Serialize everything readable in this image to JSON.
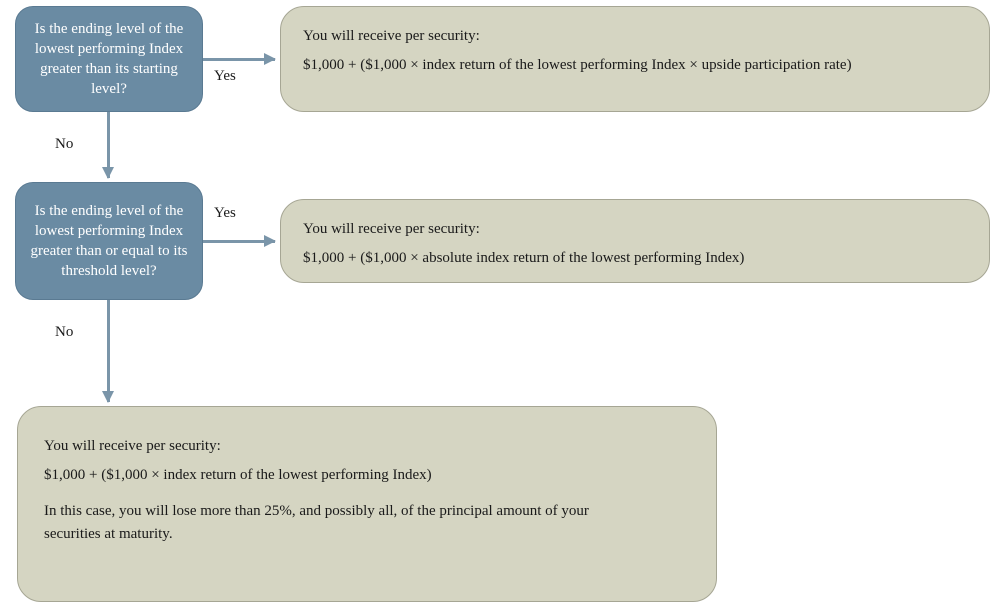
{
  "decision1": {
    "text": "Is the ending level of the lowest performing Index greater than its starting level?"
  },
  "decision2": {
    "text": "Is the ending level of the lowest performing Index greater than or equal to its threshold level?"
  },
  "result1": {
    "line1": "You will receive per security:",
    "line2": "$1,000 + ($1,000 × index return of the lowest performing Index × upside participation rate)"
  },
  "result2": {
    "line1": "You will receive per security:",
    "line2": "$1,000 + ($1,000 × absolute index return of the lowest performing Index)"
  },
  "result3": {
    "line1": "You will receive per security:",
    "line2": "$1,000 + ($1,000 × index return of the lowest performing Index)",
    "line3": "In this case, you will lose more than 25%, and possibly all, of the principal amount of your securities at maturity."
  },
  "labels": {
    "yes": "Yes",
    "no": "No"
  }
}
